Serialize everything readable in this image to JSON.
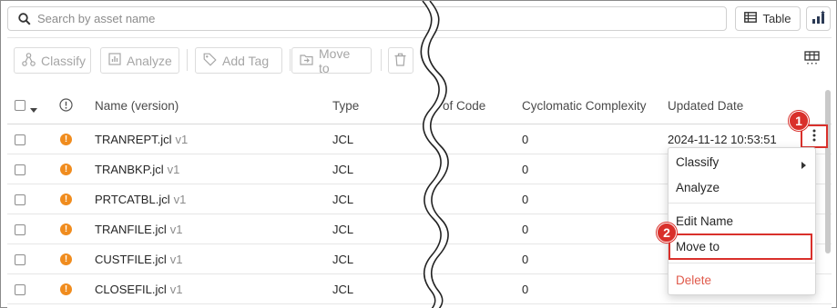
{
  "search": {
    "placeholder": "Search by asset name",
    "icon": "search-icon"
  },
  "view": {
    "table_label": "Table",
    "chart_icon": "chart-bar-icon"
  },
  "toolbar": {
    "classify": "Classify",
    "analyze": "Analyze",
    "add_tag": "Add Tag",
    "move_to": "Move to",
    "disabled_color": "#a6a6a6"
  },
  "columns": {
    "name": "Name (version)",
    "type": "Type",
    "loc": "of Code",
    "cc": "Cyclomatic Complexity",
    "updated": "Updated Date"
  },
  "rows": [
    {
      "name": "TRANREPT.jcl",
      "version": "v1",
      "type": "JCL",
      "cc": "0",
      "updated": "2024-11-12 10:53:51"
    },
    {
      "name": "TRANBKP.jcl",
      "version": "v1",
      "type": "JCL",
      "cc": "0",
      "updated": ""
    },
    {
      "name": "PRTCATBL.jcl",
      "version": "v1",
      "type": "JCL",
      "cc": "0",
      "updated": ""
    },
    {
      "name": "TRANFILE.jcl",
      "version": "v1",
      "type": "JCL",
      "cc": "0",
      "updated": ""
    },
    {
      "name": "CUSTFILE.jcl",
      "version": "v1",
      "type": "JCL",
      "cc": "0",
      "updated": ""
    },
    {
      "name": "CLOSEFIL.jcl",
      "version": "v1",
      "type": "JCL",
      "cc": "0",
      "updated": ""
    }
  ],
  "menu": {
    "classify": "Classify",
    "analyze": "Analyze",
    "edit_name": "Edit Name",
    "move_to": "Move to",
    "delete": "Delete"
  },
  "callouts": {
    "one": "1",
    "two": "2",
    "color": "#d9302b"
  },
  "colors": {
    "warning": "#f08c1e",
    "danger": "#e05a4b"
  }
}
